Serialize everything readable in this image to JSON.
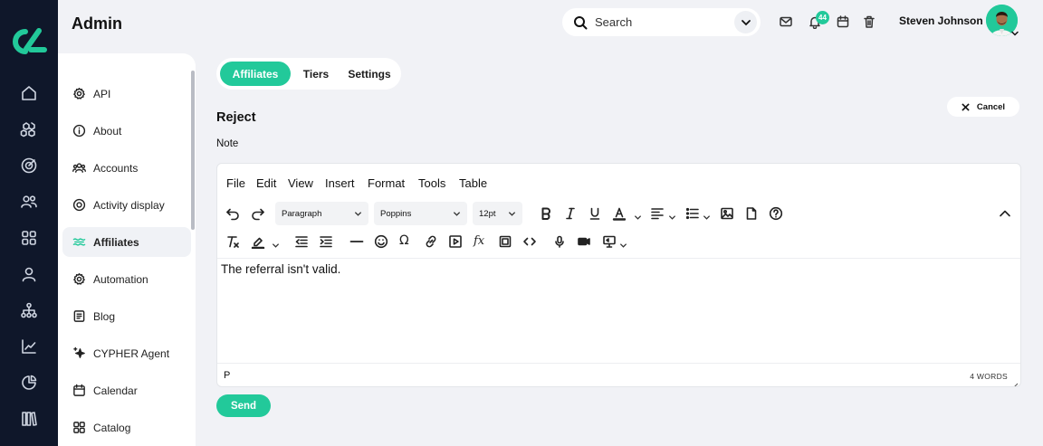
{
  "app": {
    "title": "Admin"
  },
  "header": {
    "search_placeholder": "Search",
    "notifications_count": "44",
    "user_name": "Steven Johnson"
  },
  "rail": {
    "icons": [
      "home-icon",
      "boxes-icon",
      "target-icon",
      "users-icon",
      "grid-icon",
      "user-icon",
      "network-icon",
      "chart-line-icon",
      "pie-chart-icon",
      "library-icon"
    ]
  },
  "sidebar": {
    "items": [
      {
        "label": "API",
        "icon": "gear-icon"
      },
      {
        "label": "About",
        "icon": "info-icon"
      },
      {
        "label": "Accounts",
        "icon": "users-icon"
      },
      {
        "label": "Activity display",
        "icon": "target-icon"
      },
      {
        "label": "Affiliates",
        "icon": "affiliates-icon",
        "active": true
      },
      {
        "label": "Automation",
        "icon": "gear-icon"
      },
      {
        "label": "Blog",
        "icon": "document-icon"
      },
      {
        "label": "CYPHER Agent",
        "icon": "sparkle-icon"
      },
      {
        "label": "Calendar",
        "icon": "calendar-icon"
      },
      {
        "label": "Catalog",
        "icon": "grid-icon"
      }
    ]
  },
  "tabs": [
    {
      "label": "Affiliates",
      "active": true
    },
    {
      "label": "Tiers"
    },
    {
      "label": "Settings"
    }
  ],
  "actions": {
    "cancel_label": "Cancel",
    "send_label": "Send"
  },
  "form": {
    "title": "Reject",
    "note_label": "Note"
  },
  "editor": {
    "menu": [
      "File",
      "Edit",
      "View",
      "Insert",
      "Format",
      "Tools",
      "Table"
    ],
    "block_format": "Paragraph",
    "font_family": "Poppins",
    "font_size": "12pt",
    "content": "The referral isn't valid.",
    "status_path": "P",
    "word_count": "4 WORDS"
  },
  "colors": {
    "accent": "#22c99a",
    "rail": "#0f172a",
    "background": "#f1f2f6"
  }
}
